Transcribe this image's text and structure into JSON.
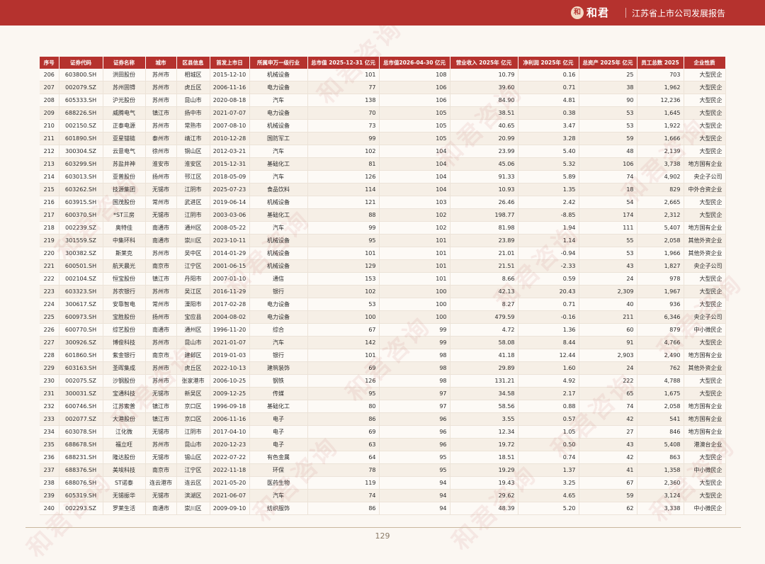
{
  "header": {
    "brand": "和君",
    "report_title": "江苏省上市公司发展报告"
  },
  "watermark_text": "和君咨询",
  "table": {
    "columns": [
      "序号",
      "证券代码",
      "证券名称",
      "城市",
      "区县信息",
      "首发上市日",
      "所属申万一级行业",
      "总市值 2025-12-31 亿元",
      "总市值2026-04-30 亿元",
      "营业收入 2025年 亿元",
      "净利润 2025年 亿元",
      "总资产 2025年 亿元",
      "员工总数 2025",
      "企业性质"
    ],
    "rows": [
      [
        "206",
        "603800.SH",
        "洪田股份",
        "苏州市",
        "相城区",
        "2015-12-10",
        "机械设备",
        "101",
        "108",
        "10.79",
        "0.16",
        "25",
        "703",
        "大型民企"
      ],
      [
        "207",
        "002079.SZ",
        "苏州固锝",
        "苏州市",
        "虎丘区",
        "2006-11-16",
        "电力设备",
        "77",
        "106",
        "39.60",
        "0.71",
        "38",
        "1,962",
        "大型民企"
      ],
      [
        "208",
        "605333.SH",
        "沪光股份",
        "苏州市",
        "昆山市",
        "2020-08-18",
        "汽车",
        "138",
        "106",
        "84.90",
        "4.81",
        "90",
        "12,236",
        "大型民企"
      ],
      [
        "209",
        "688226.SH",
        "威腾电气",
        "镇江市",
        "扬中市",
        "2021-07-07",
        "电力设备",
        "70",
        "105",
        "38.51",
        "0.38",
        "53",
        "1,645",
        "大型民企"
      ],
      [
        "210",
        "002150.SZ",
        "正泰电源",
        "苏州市",
        "常熟市",
        "2007-08-10",
        "机械设备",
        "73",
        "105",
        "40.65",
        "3.47",
        "53",
        "1,922",
        "大型民企"
      ],
      [
        "211",
        "601890.SH",
        "亚星锚链",
        "泰州市",
        "靖江市",
        "2010-12-28",
        "国防军工",
        "99",
        "105",
        "20.99",
        "3.28",
        "59",
        "1,666",
        "大型民企"
      ],
      [
        "212",
        "300304.SZ",
        "云意电气",
        "徐州市",
        "铜山区",
        "2012-03-21",
        "汽车",
        "102",
        "104",
        "23.99",
        "5.40",
        "48",
        "2,139",
        "大型民企"
      ],
      [
        "213",
        "603299.SH",
        "苏盐井神",
        "淮安市",
        "淮安区",
        "2015-12-31",
        "基础化工",
        "81",
        "104",
        "45.06",
        "5.32",
        "106",
        "3,738",
        "地方国有企业"
      ],
      [
        "214",
        "603013.SH",
        "亚普股份",
        "扬州市",
        "邗江区",
        "2018-05-09",
        "汽车",
        "126",
        "104",
        "91.33",
        "5.89",
        "74",
        "4,902",
        "央企子公司"
      ],
      [
        "215",
        "603262.SH",
        "技源集团",
        "无锡市",
        "江阴市",
        "2025-07-23",
        "食品饮料",
        "114",
        "104",
        "10.93",
        "1.35",
        "18",
        "829",
        "中外合资企业"
      ],
      [
        "216",
        "603915.SH",
        "国茂股份",
        "常州市",
        "武进区",
        "2019-06-14",
        "机械设备",
        "121",
        "103",
        "26.46",
        "2.42",
        "54",
        "2,665",
        "大型民企"
      ],
      [
        "217",
        "600370.SH",
        "*ST三房",
        "无锡市",
        "江阴市",
        "2003-03-06",
        "基础化工",
        "88",
        "102",
        "198.77",
        "-8.85",
        "174",
        "2,312",
        "大型民企"
      ],
      [
        "218",
        "002239.SZ",
        "奥特佳",
        "南通市",
        "通州区",
        "2008-05-22",
        "汽车",
        "99",
        "102",
        "81.98",
        "1.94",
        "111",
        "5,407",
        "地方国有企业"
      ],
      [
        "219",
        "301559.SZ",
        "中集环科",
        "南通市",
        "崇川区",
        "2023-10-11",
        "机械设备",
        "95",
        "101",
        "23.89",
        "1.14",
        "55",
        "2,058",
        "其他外资企业"
      ],
      [
        "220",
        "300382.SZ",
        "斯莱克",
        "苏州市",
        "吴中区",
        "2014-01-29",
        "机械设备",
        "101",
        "101",
        "21.01",
        "-0.94",
        "53",
        "1,966",
        "其他外资企业"
      ],
      [
        "221",
        "600501.SH",
        "航天晨光",
        "南京市",
        "江宁区",
        "2001-06-15",
        "机械设备",
        "129",
        "101",
        "21.51",
        "-2.33",
        "43",
        "1,827",
        "央企子公司"
      ],
      [
        "222",
        "002104.SZ",
        "恒宝股份",
        "镇江市",
        "丹阳市",
        "2007-01-10",
        "通信",
        "153",
        "101",
        "8.66",
        "0.59",
        "24",
        "978",
        "大型民企"
      ],
      [
        "223",
        "603323.SH",
        "苏农银行",
        "苏州市",
        "吴江区",
        "2016-11-29",
        "银行",
        "102",
        "100",
        "42.13",
        "20.43",
        "2,309",
        "1,967",
        "大型民企"
      ],
      [
        "224",
        "300617.SZ",
        "安靠智电",
        "常州市",
        "溧阳市",
        "2017-02-28",
        "电力设备",
        "53",
        "100",
        "8.27",
        "0.71",
        "40",
        "936",
        "大型民企"
      ],
      [
        "225",
        "600973.SH",
        "宝胜股份",
        "扬州市",
        "宝应县",
        "2004-08-02",
        "电力设备",
        "100",
        "100",
        "479.59",
        "-0.16",
        "211",
        "6,346",
        "央企子公司"
      ],
      [
        "226",
        "600770.SH",
        "综艺股份",
        "南通市",
        "通州区",
        "1996-11-20",
        "综合",
        "67",
        "99",
        "4.72",
        "1.36",
        "60",
        "879",
        "中小微民企"
      ],
      [
        "227",
        "300926.SZ",
        "博俊科技",
        "苏州市",
        "昆山市",
        "2021-01-07",
        "汽车",
        "142",
        "99",
        "58.08",
        "8.44",
        "91",
        "4,766",
        "大型民企"
      ],
      [
        "228",
        "601860.SH",
        "紫金银行",
        "南京市",
        "建邺区",
        "2019-01-03",
        "银行",
        "101",
        "98",
        "41.18",
        "12.44",
        "2,903",
        "2,490",
        "地方国有企业"
      ],
      [
        "229",
        "603163.SH",
        "圣晖集成",
        "苏州市",
        "虎丘区",
        "2022-10-13",
        "建筑装饰",
        "69",
        "98",
        "29.89",
        "1.60",
        "24",
        "762",
        "其他外资企业"
      ],
      [
        "230",
        "002075.SZ",
        "沙钢股份",
        "苏州市",
        "张家港市",
        "2006-10-25",
        "钢铁",
        "126",
        "98",
        "131.21",
        "4.92",
        "222",
        "4,788",
        "大型民企"
      ],
      [
        "231",
        "300031.SZ",
        "宝通科技",
        "无锡市",
        "新吴区",
        "2009-12-25",
        "传媒",
        "95",
        "97",
        "34.58",
        "2.17",
        "65",
        "1,675",
        "大型民企"
      ],
      [
        "232",
        "600746.SH",
        "江苏索普",
        "镇江市",
        "京口区",
        "1996-09-18",
        "基础化工",
        "80",
        "97",
        "58.56",
        "0.88",
        "74",
        "2,058",
        "地方国有企业"
      ],
      [
        "233",
        "002077.SZ",
        "大港股份",
        "镇江市",
        "京口区",
        "2006-11-16",
        "电子",
        "86",
        "96",
        "3.55",
        "0.57",
        "42",
        "541",
        "地方国有企业"
      ],
      [
        "234",
        "603078.SH",
        "江化微",
        "无锡市",
        "江阴市",
        "2017-04-10",
        "电子",
        "69",
        "96",
        "12.34",
        "1.05",
        "27",
        "846",
        "地方国有企业"
      ],
      [
        "235",
        "688678.SH",
        "福立旺",
        "苏州市",
        "昆山市",
        "2020-12-23",
        "电子",
        "63",
        "96",
        "19.72",
        "0.50",
        "43",
        "5,408",
        "港澳台企业"
      ],
      [
        "236",
        "688231.SH",
        "隆达股份",
        "无锡市",
        "锡山区",
        "2022-07-22",
        "有色金属",
        "64",
        "95",
        "18.51",
        "0.74",
        "42",
        "863",
        "大型民企"
      ],
      [
        "237",
        "688376.SH",
        "美埃科技",
        "南京市",
        "江宁区",
        "2022-11-18",
        "环保",
        "78",
        "95",
        "19.29",
        "1.37",
        "41",
        "1,358",
        "中小微民企"
      ],
      [
        "238",
        "688076.SH",
        "ST诺泰",
        "连云港市",
        "连云区",
        "2021-05-20",
        "医药生物",
        "119",
        "94",
        "19.43",
        "3.25",
        "67",
        "2,360",
        "大型民企"
      ],
      [
        "239",
        "605319.SH",
        "无锡振华",
        "无锡市",
        "滨湖区",
        "2021-06-07",
        "汽车",
        "74",
        "94",
        "29.62",
        "4.65",
        "59",
        "3,124",
        "大型民企"
      ],
      [
        "240",
        "002293.SZ",
        "罗莱生活",
        "南通市",
        "崇川区",
        "2009-09-10",
        "纺织服饰",
        "86",
        "94",
        "48.39",
        "5.20",
        "62",
        "3,338",
        "中小微民企"
      ]
    ]
  },
  "footer": {
    "page_number": "129"
  }
}
